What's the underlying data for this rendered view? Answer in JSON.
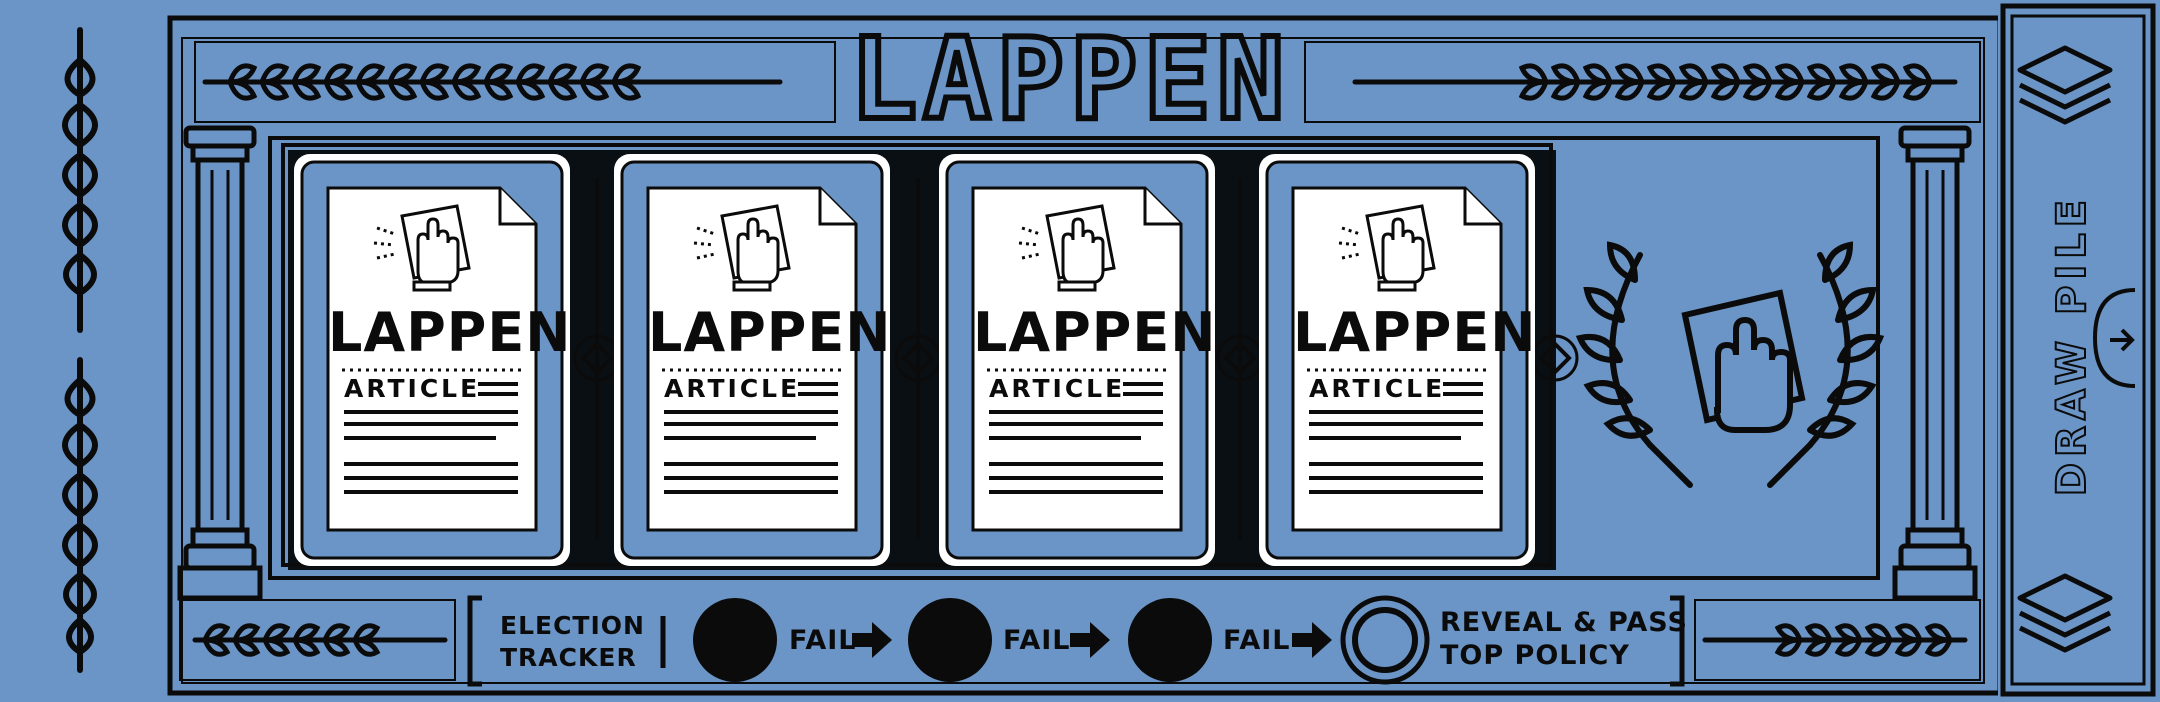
{
  "board": {
    "title": "LAPPEN",
    "colors": {
      "board_blue": "#6b95c6",
      "ink": "#0b0b0b",
      "card_white": "#ffffff"
    }
  },
  "policy_slots": [
    {
      "card_title": "LAPPEN",
      "card_subtitle": "ARTICLE",
      "icon": "hand-stamp-icon"
    },
    {
      "card_title": "LAPPEN",
      "card_subtitle": "ARTICLE",
      "icon": "hand-stamp-icon"
    },
    {
      "card_title": "LAPPEN",
      "card_subtitle": "ARTICLE",
      "icon": "hand-stamp-icon"
    },
    {
      "card_title": "LAPPEN",
      "card_subtitle": "ARTICLE",
      "icon": "hand-stamp-icon"
    }
  ],
  "victory_emblem": {
    "icon": "laurel-wreath-hand-icon"
  },
  "election_tracker": {
    "label_line1": "ELECTION",
    "label_line2": "TRACKER",
    "steps": [
      {
        "label": "FAIL",
        "filled": true
      },
      {
        "label": "FAIL",
        "filled": true
      },
      {
        "label": "FAIL",
        "filled": true
      }
    ],
    "final_line1": "REVEAL & PASS",
    "final_line2": "TOP POLICY"
  },
  "draw_pile": {
    "label": "DRAW PILE",
    "icon": "card-stack-icon"
  }
}
